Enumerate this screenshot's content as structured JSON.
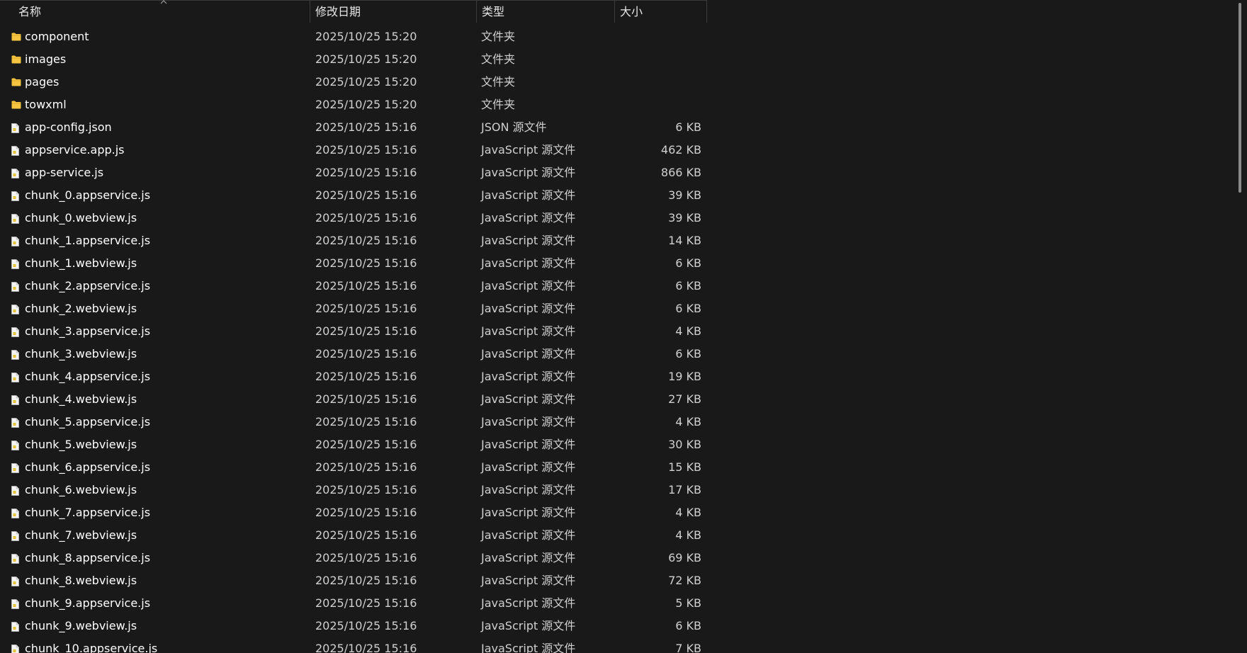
{
  "columns": {
    "name": "名称",
    "date": "修改日期",
    "type": "类型",
    "size": "大小"
  },
  "files": [
    {
      "name": "component",
      "date": "2025/10/25 15:20",
      "type": "文件夹",
      "size": "",
      "kind": "folder"
    },
    {
      "name": "images",
      "date": "2025/10/25 15:20",
      "type": "文件夹",
      "size": "",
      "kind": "folder"
    },
    {
      "name": "pages",
      "date": "2025/10/25 15:20",
      "type": "文件夹",
      "size": "",
      "kind": "folder"
    },
    {
      "name": "towxml",
      "date": "2025/10/25 15:20",
      "type": "文件夹",
      "size": "",
      "kind": "folder"
    },
    {
      "name": "app-config.json",
      "date": "2025/10/25 15:16",
      "type": "JSON 源文件",
      "size": "6 KB",
      "kind": "file"
    },
    {
      "name": "appservice.app.js",
      "date": "2025/10/25 15:16",
      "type": "JavaScript 源文件",
      "size": "462 KB",
      "kind": "file"
    },
    {
      "name": "app-service.js",
      "date": "2025/10/25 15:16",
      "type": "JavaScript 源文件",
      "size": "866 KB",
      "kind": "file"
    },
    {
      "name": "chunk_0.appservice.js",
      "date": "2025/10/25 15:16",
      "type": "JavaScript 源文件",
      "size": "39 KB",
      "kind": "file"
    },
    {
      "name": "chunk_0.webview.js",
      "date": "2025/10/25 15:16",
      "type": "JavaScript 源文件",
      "size": "39 KB",
      "kind": "file"
    },
    {
      "name": "chunk_1.appservice.js",
      "date": "2025/10/25 15:16",
      "type": "JavaScript 源文件",
      "size": "14 KB",
      "kind": "file"
    },
    {
      "name": "chunk_1.webview.js",
      "date": "2025/10/25 15:16",
      "type": "JavaScript 源文件",
      "size": "6 KB",
      "kind": "file"
    },
    {
      "name": "chunk_2.appservice.js",
      "date": "2025/10/25 15:16",
      "type": "JavaScript 源文件",
      "size": "6 KB",
      "kind": "file"
    },
    {
      "name": "chunk_2.webview.js",
      "date": "2025/10/25 15:16",
      "type": "JavaScript 源文件",
      "size": "6 KB",
      "kind": "file"
    },
    {
      "name": "chunk_3.appservice.js",
      "date": "2025/10/25 15:16",
      "type": "JavaScript 源文件",
      "size": "4 KB",
      "kind": "file"
    },
    {
      "name": "chunk_3.webview.js",
      "date": "2025/10/25 15:16",
      "type": "JavaScript 源文件",
      "size": "6 KB",
      "kind": "file"
    },
    {
      "name": "chunk_4.appservice.js",
      "date": "2025/10/25 15:16",
      "type": "JavaScript 源文件",
      "size": "19 KB",
      "kind": "file"
    },
    {
      "name": "chunk_4.webview.js",
      "date": "2025/10/25 15:16",
      "type": "JavaScript 源文件",
      "size": "27 KB",
      "kind": "file"
    },
    {
      "name": "chunk_5.appservice.js",
      "date": "2025/10/25 15:16",
      "type": "JavaScript 源文件",
      "size": "4 KB",
      "kind": "file"
    },
    {
      "name": "chunk_5.webview.js",
      "date": "2025/10/25 15:16",
      "type": "JavaScript 源文件",
      "size": "30 KB",
      "kind": "file"
    },
    {
      "name": "chunk_6.appservice.js",
      "date": "2025/10/25 15:16",
      "type": "JavaScript 源文件",
      "size": "15 KB",
      "kind": "file"
    },
    {
      "name": "chunk_6.webview.js",
      "date": "2025/10/25 15:16",
      "type": "JavaScript 源文件",
      "size": "17 KB",
      "kind": "file"
    },
    {
      "name": "chunk_7.appservice.js",
      "date": "2025/10/25 15:16",
      "type": "JavaScript 源文件",
      "size": "4 KB",
      "kind": "file"
    },
    {
      "name": "chunk_7.webview.js",
      "date": "2025/10/25 15:16",
      "type": "JavaScript 源文件",
      "size": "4 KB",
      "kind": "file"
    },
    {
      "name": "chunk_8.appservice.js",
      "date": "2025/10/25 15:16",
      "type": "JavaScript 源文件",
      "size": "69 KB",
      "kind": "file"
    },
    {
      "name": "chunk_8.webview.js",
      "date": "2025/10/25 15:16",
      "type": "JavaScript 源文件",
      "size": "72 KB",
      "kind": "file"
    },
    {
      "name": "chunk_9.appservice.js",
      "date": "2025/10/25 15:16",
      "type": "JavaScript 源文件",
      "size": "5 KB",
      "kind": "file"
    },
    {
      "name": "chunk_9.webview.js",
      "date": "2025/10/25 15:16",
      "type": "JavaScript 源文件",
      "size": "6 KB",
      "kind": "file"
    },
    {
      "name": "chunk_10.appservice.js",
      "date": "2025/10/25 15:16",
      "type": "JavaScript 源文件",
      "size": "7 KB",
      "kind": "file"
    }
  ],
  "icons": {
    "folder": "folder-icon",
    "file": "file-icon",
    "sort": "sort-up-icon"
  },
  "colors": {
    "background": "#191919",
    "folder": "#f5c542",
    "text": "#ffffff",
    "muted": "#d0d0d0"
  }
}
